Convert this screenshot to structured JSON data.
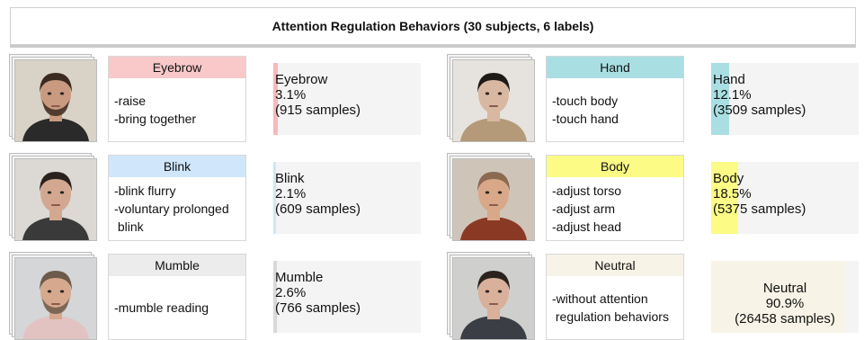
{
  "title": "Attention Regulation Behaviors (30 subjects, 6 labels)",
  "behaviors": [
    {
      "label": "Eyebrow",
      "color": "#f9c9ca",
      "bar_color": "#f7b9ba",
      "actions": [
        "-raise",
        "-bring together"
      ],
      "stat_label": "Eyebrow",
      "percent": "3.1%",
      "percent_value": 3.1,
      "samples": "(915 samples)",
      "face": {
        "skin": "#c99a80",
        "hair": "#3b2a20",
        "bg": "#d9d2c6",
        "shirt": "#2a2a2a",
        "beard": true
      }
    },
    {
      "label": "Hand",
      "color": "#a9dfe3",
      "bar_color": "#a9dfe3",
      "actions": [
        "-touch body",
        "-touch hand"
      ],
      "stat_label": "Hand",
      "percent": "12.1%",
      "percent_value": 12.1,
      "samples": "(3509 samples)",
      "face": {
        "skin": "#d8b8a0",
        "hair": "#1e1a18",
        "bg": "#e6e3de",
        "shirt": "#b49a78",
        "beard": false
      }
    },
    {
      "label": "Blink",
      "color": "#cfe6fb",
      "bar_color": "#cfe6fb",
      "actions": [
        "-blink flurry",
        "-voluntary prolonged",
        " blink"
      ],
      "stat_label": "Blink",
      "percent": "2.1%",
      "percent_value": 2.1,
      "samples": "(609 samples)",
      "face": {
        "skin": "#d3a890",
        "hair": "#2a211c",
        "bg": "#dcd9d4",
        "shirt": "#3a3a3a",
        "beard": false
      }
    },
    {
      "label": "Body",
      "color": "#fbfb86",
      "bar_color": "#fbfb86",
      "actions": [
        "-adjust torso",
        "-adjust arm",
        "-adjust head"
      ],
      "stat_label": "Body",
      "percent": "18.5%",
      "percent_value": 18.5,
      "samples": "(5375 samples)",
      "face": {
        "skin": "#d8a888",
        "hair": "#8a6a50",
        "bg": "#cfc4b8",
        "shirt": "#8a3a24",
        "beard": false
      }
    },
    {
      "label": "Mumble",
      "color": "#ececec",
      "bar_color": "#d9d9d9",
      "actions": [
        "-mumble reading"
      ],
      "stat_label": "Mumble",
      "percent": "2.6%",
      "percent_value": 2.6,
      "samples": "(766 samples)",
      "face": {
        "skin": "#d6a98e",
        "hair": "#6d5a4a",
        "bg": "#d4d6d8",
        "shirt": "#e3c2c2",
        "beard": true
      }
    },
    {
      "label": "Neutral",
      "color": "#f7f3e6",
      "bar_color": "#f7f3e6",
      "actions": [
        "-without attention",
        " regulation behaviors"
      ],
      "stat_label": "Neutral",
      "percent": "90.9%",
      "percent_value": 90.9,
      "samples": "(26458 samples)",
      "face": {
        "skin": "#d9b09a",
        "hair": "#2b221d",
        "bg": "#cfd0cd",
        "shirt": "#3b3f45",
        "beard": false
      }
    }
  ]
}
